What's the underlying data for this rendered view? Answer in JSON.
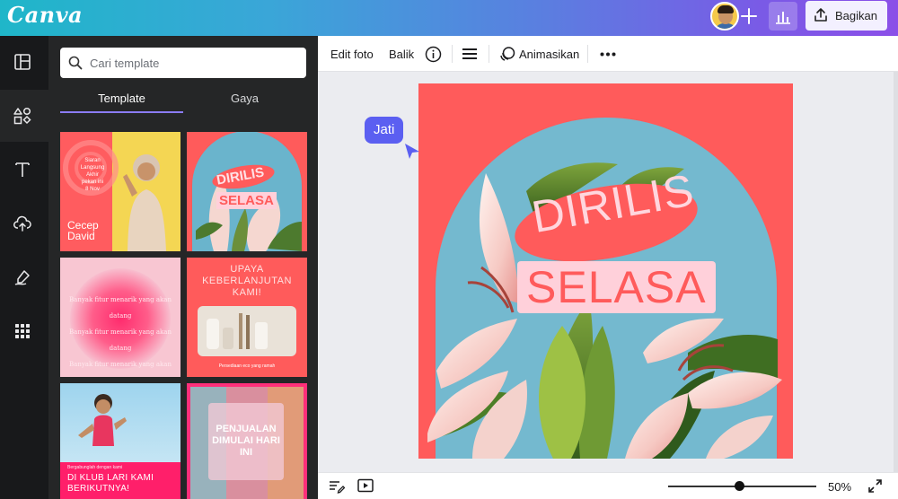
{
  "app": {
    "logo": "Canva"
  },
  "header": {
    "share_label": "Bagikan"
  },
  "search": {
    "placeholder": "Cari template"
  },
  "panel_tabs": [
    {
      "label": "Template"
    },
    {
      "label": "Gaya"
    }
  ],
  "templates": [
    {
      "name": "Cecep David",
      "lines": [
        "Siaran Langsung",
        "Akhir",
        "pekan ini",
        "8 Nov"
      ]
    },
    {
      "title_1": "DIRILIS",
      "title_2": "SELASA"
    },
    {
      "repeat_text": "Banyak fitur menarik yang akan datang"
    },
    {
      "heading": "UPAYA KEBERLANJUTAN KAMI!",
      "caption": "Persediaan eco yang ramah"
    },
    {
      "small": "Bergabunglah dengan kami",
      "cta": "DI KLUB LARI KAMI BERIKUTNYA!"
    },
    {
      "heading": "PENJUALAN DIMULAI HARI INI"
    }
  ],
  "toolbar": {
    "edit_photo": "Edit foto",
    "flip": "Balik",
    "animate": "Animasikan"
  },
  "design": {
    "line_1": "DIRILIS",
    "line_2": "SELASA"
  },
  "collaborator": {
    "name": "Jati"
  },
  "zoom": {
    "label": "50%",
    "value": 0.5
  },
  "colors": {
    "accent": "#8b7cf6",
    "design_bg": "#ff5b5b",
    "collab": "#5b5ff1",
    "share_bg": "#f3f0ff"
  }
}
